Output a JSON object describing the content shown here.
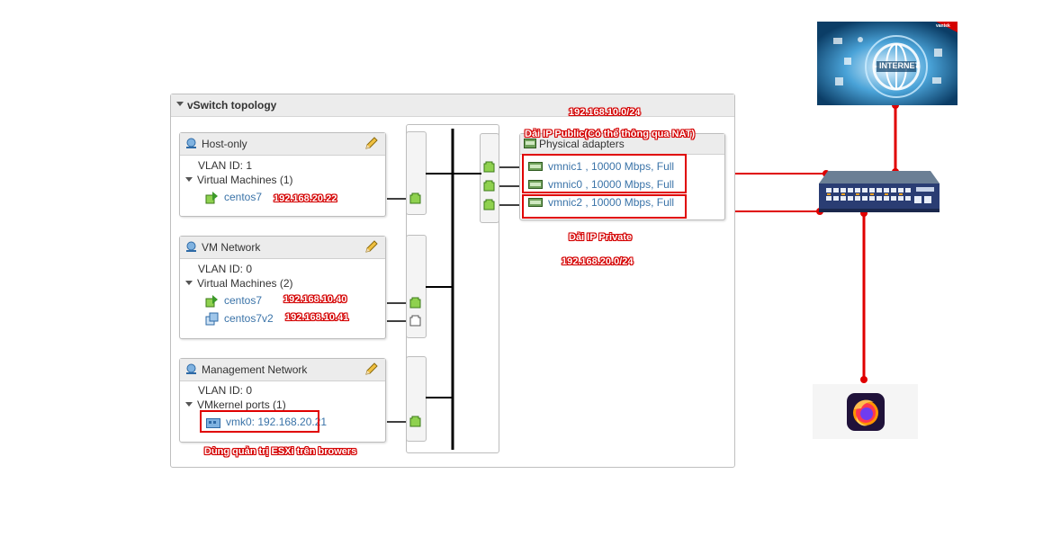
{
  "panel": {
    "title": "vSwitch topology"
  },
  "portgroups": [
    {
      "name": "Host-only",
      "vlan": "VLAN ID: 1",
      "members_label": "Virtual Machines (1)",
      "members": [
        {
          "name": "centos7",
          "ip": "192.168.20.22"
        }
      ]
    },
    {
      "name": "VM Network",
      "vlan": "VLAN ID: 0",
      "members_label": "Virtual Machines (2)",
      "members": [
        {
          "name": "centos7",
          "ip": "192.168.10.40"
        },
        {
          "name": "centos7v2",
          "ip": "192.168.10.41"
        }
      ]
    },
    {
      "name": "Management Network",
      "vlan": "VLAN ID: 0",
      "members_label": "VMkernel ports (1)",
      "members": [
        {
          "name": "vmk0: 192.168.20.21",
          "note": "Dùng quản trị ESXi trên browers"
        }
      ]
    }
  ],
  "physical": {
    "title": "Physical adapters",
    "adapters": [
      {
        "name": "vmnic1",
        "speed": " , 10000 Mbps, Full"
      },
      {
        "name": "vmnic0",
        "speed": " , 10000 Mbps, Full"
      },
      {
        "name": "vmnic2",
        "speed": " , 10000 Mbps, Full"
      }
    ]
  },
  "annotations": {
    "public_subnet": "192.168.10.0/24",
    "public_label": "Dải IP Public(Có thể thông qua NAT)",
    "private_label": "Dải IP Private",
    "private_subnet": "192.168.20.0/24"
  },
  "internet_image": {
    "text": "INTERNET",
    "brand": "vantek"
  },
  "colors": {
    "annotation": "#e00000",
    "link": "#3a73a8",
    "port_green": "#8fd14f"
  }
}
